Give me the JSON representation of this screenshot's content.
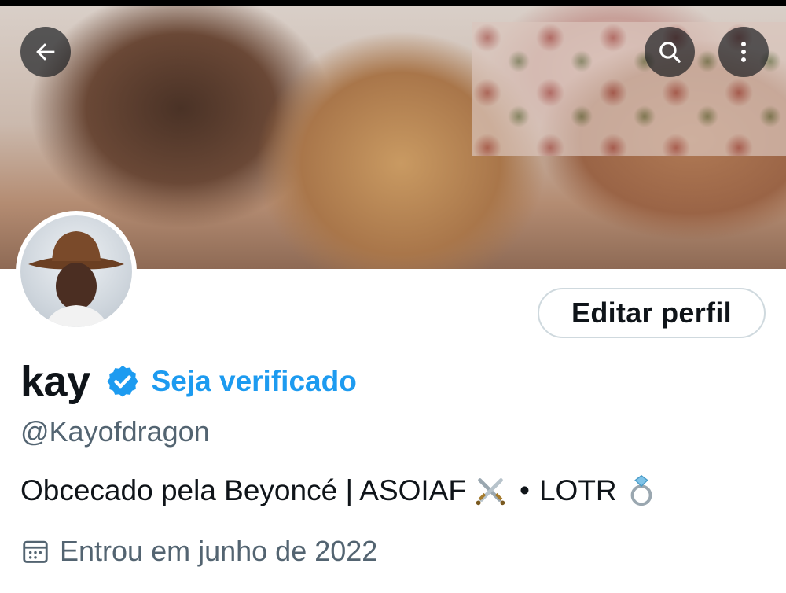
{
  "header": {
    "back": "back-arrow-icon",
    "search": "search-icon",
    "more": "more-vertical-icon"
  },
  "profile": {
    "name": "kay",
    "get_verified_label": "Seja verificado",
    "handle": "@Kayofdragon",
    "bio_text": "Obcecado pela Beyoncé | ASOIAF",
    "bio_separator": "•",
    "bio_text_2": "LOTR",
    "joined": "Entrou em junho de 2022",
    "edit_profile_label": "Editar perfil"
  },
  "colors": {
    "accent": "#1d9bf0",
    "text_primary": "#0f1419",
    "text_secondary": "#536471",
    "border": "#cfd9de"
  }
}
